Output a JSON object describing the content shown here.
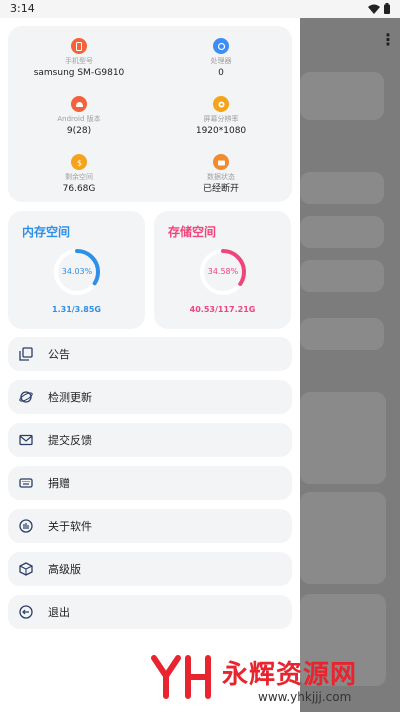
{
  "status_bar": {
    "time": "3:14"
  },
  "device_info": [
    {
      "label": "手机型号",
      "value": "samsung SM-G9810",
      "icon": "phone-icon",
      "color": "#f4623a"
    },
    {
      "label": "处理器",
      "value": "0",
      "icon": "cpu-icon",
      "color": "#3d8df5"
    },
    {
      "label": "Android 版本",
      "value": "9(28)",
      "icon": "android-icon",
      "color": "#f4623a"
    },
    {
      "label": "屏幕分辨率",
      "value": "1920*1080",
      "icon": "screen-icon",
      "color": "#f6a31c"
    },
    {
      "label": "剩余空间",
      "value": "76.68G",
      "icon": "storage-icon",
      "color": "#f6a31c"
    },
    {
      "label": "数据状态",
      "value": "已经断开",
      "icon": "data-icon",
      "color": "#f28a2e"
    }
  ],
  "memory": {
    "title": "内存空间",
    "percent": "34.03%",
    "value": "1.31/3.85G",
    "color": "#2e8fe8",
    "fraction": 0.3403
  },
  "storage": {
    "title": "存储空间",
    "percent": "34.58%",
    "value": "40.53/117.21G",
    "color": "#f0457a",
    "fraction": 0.3458
  },
  "menu": [
    {
      "label": "公告",
      "icon": "announcement-icon"
    },
    {
      "label": "检测更新",
      "icon": "update-icon"
    },
    {
      "label": "提交反馈",
      "icon": "feedback-icon"
    },
    {
      "label": "捐赠",
      "icon": "donate-icon"
    },
    {
      "label": "关于软件",
      "icon": "about-icon"
    },
    {
      "label": "高级版",
      "icon": "premium-icon"
    },
    {
      "label": "退出",
      "icon": "exit-icon"
    }
  ],
  "watermark": {
    "brand": "永辉资源网",
    "url": "www.yhkjjj.com"
  }
}
